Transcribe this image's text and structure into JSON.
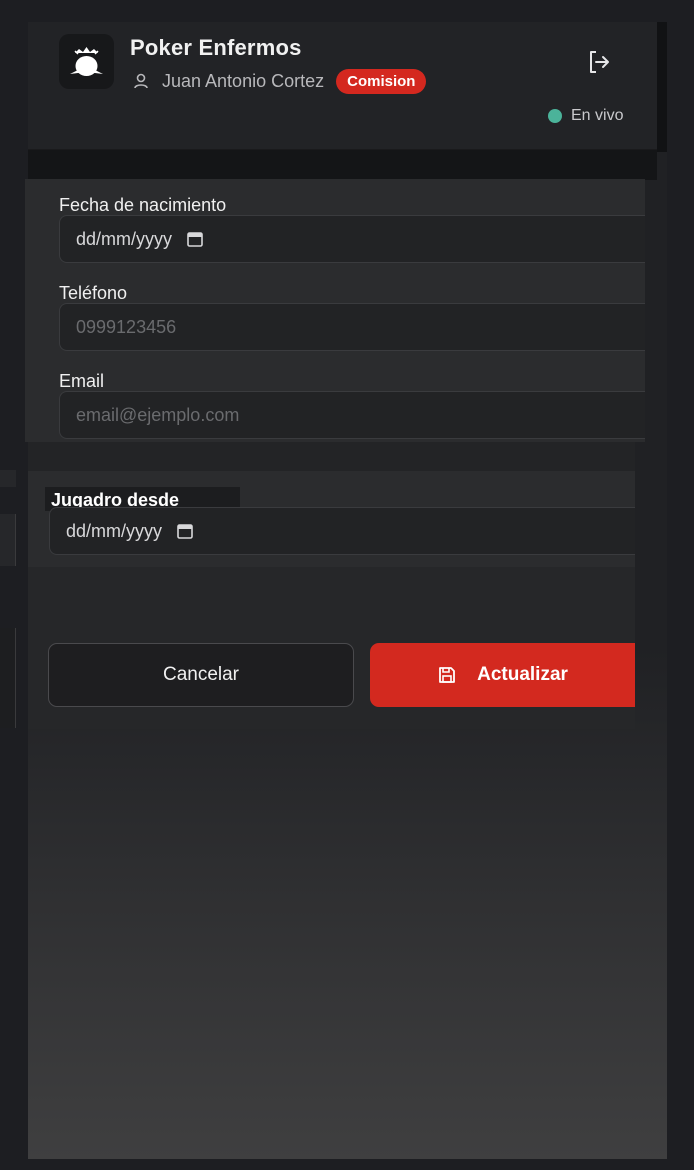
{
  "header": {
    "app_title": "Poker Enfermos",
    "user_name": "Juan Antonio Cortez",
    "role_badge": "Comision",
    "status_text": "En vivo",
    "status_color": "#4bb39a"
  },
  "form": {
    "birthdate": {
      "label": "Fecha de nacimiento",
      "value": "dd/mm/yyyy"
    },
    "phone": {
      "label": "Teléfono",
      "placeholder": "0999123456"
    },
    "email": {
      "label": "Email",
      "placeholder": "email@ejemplo.com"
    },
    "player_since": {
      "label": "Jugadro desde",
      "value": "dd/mm/yyyy"
    }
  },
  "actions": {
    "cancel_label": "Cancelar",
    "update_label": "Actualizar"
  },
  "colors": {
    "accent": "#d3291f",
    "background": "#1d1e22"
  },
  "icons": [
    "poker-logo-icon",
    "user-icon",
    "logout-icon",
    "calendar-icon",
    "save-icon"
  ]
}
